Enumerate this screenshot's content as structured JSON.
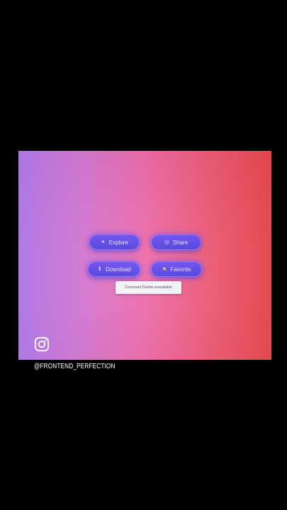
{
  "buttons": {
    "explore": {
      "label": "Explore",
      "icon": "compass-icon"
    },
    "share": {
      "label": "Share",
      "icon": "share-icon"
    },
    "download": {
      "label": "Download",
      "icon": "download-icon"
    },
    "favorite": {
      "label": "Favorite",
      "icon": "star-icon"
    }
  },
  "toast": {
    "text": "Command Palette unavailable"
  },
  "watermark": {
    "handle": "@FRONTEND_PERFECTION",
    "icon": "instagram-icon"
  },
  "colors": {
    "background": "#000000",
    "gradient_start": "#b77cf0",
    "gradient_end": "#ee4a4e",
    "button": "#5b45ea",
    "toast": "#f4f4f8"
  }
}
